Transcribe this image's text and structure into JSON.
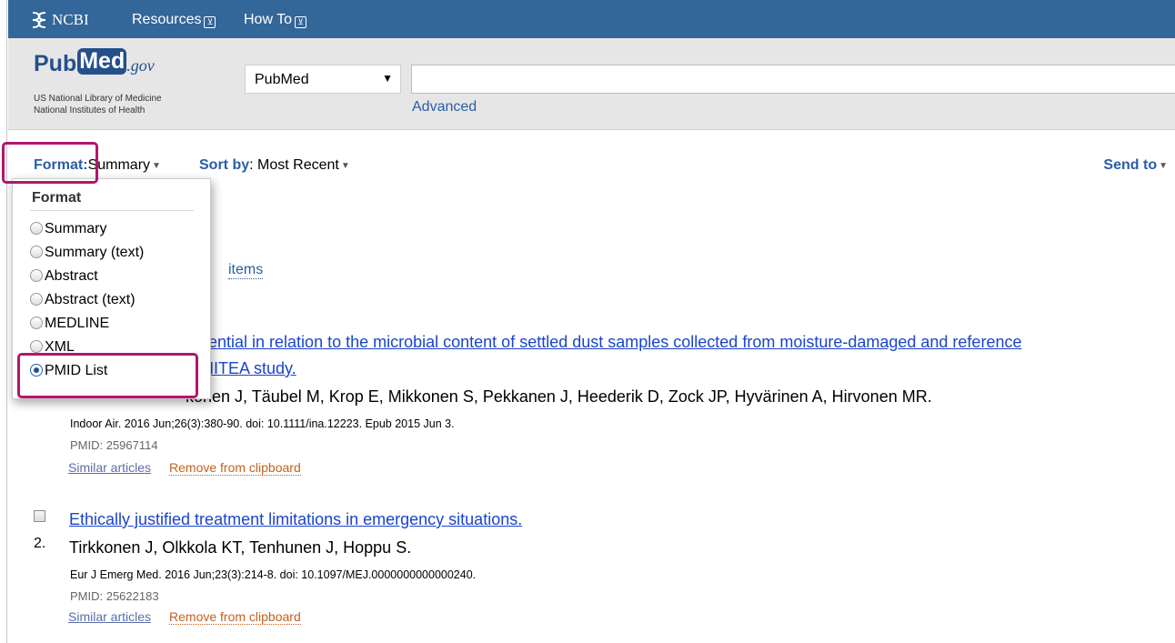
{
  "ncbi_bar": {
    "logo": "NCBI",
    "resources": "Resources",
    "howto": "How To",
    "menu_chevron": "⊻"
  },
  "header": {
    "logo_pub": "Pub",
    "logo_med": "Med",
    "logo_gov": ".gov",
    "subtitle_line1": "US National Library of Medicine",
    "subtitle_line2": "National Institutes of Health",
    "db_selected": "PubMed",
    "search_value": "",
    "advanced": "Advanced"
  },
  "toolbar": {
    "format_label": "Format",
    "format_colon": ":",
    "format_value": "Summary",
    "sort_label": "Sort by",
    "sort_colon": ": ",
    "sort_value": "Most Recent",
    "send_to": "Send to",
    "caret": "▼"
  },
  "format_menu": {
    "title": "Format",
    "options": [
      "Summary",
      "Summary (text)",
      "Abstract",
      "Abstract (text)",
      "MEDLINE",
      "XML",
      "PMID List"
    ],
    "selected": "PMID List"
  },
  "results": {
    "items_link": "items",
    "items": [
      {
        "title_part1": "ential in relation to the microbial content of settled dust samples collected from moisture-damaged and reference",
        "title_part2": "f HITEA study.",
        "authors": "konen J, Täubel M, Krop E, Mikkonen S, Pekkanen J, Heederik D, Zock JP, Hyvärinen A, Hirvonen MR.",
        "journal": "Indoor Air. 2016 Jun;26(3):380-90. doi: 10.1111/ina.12223. Epub 2015 Jun 3.",
        "pmid": "PMID: 25967114",
        "similar": "Similar articles",
        "remove": "Remove from clipboard"
      },
      {
        "number": "2.",
        "title": "Ethically justified treatment limitations in emergency situations.",
        "authors": "Tirkkonen J, Olkkola KT, Tenhunen J, Hoppu S.",
        "journal": "Eur J Emerg Med. 2016 Jun;23(3):214-8. doi: 10.1097/MEJ.0000000000000240.",
        "pmid": "PMID: 25622183",
        "similar": "Similar articles",
        "remove": "Remove from clipboard"
      }
    ]
  },
  "colors": {
    "ncbi_bar": "#336699",
    "link_blue": "#1a44cc",
    "highlight": "#b2166f",
    "remove_orange": "#c3601e"
  }
}
